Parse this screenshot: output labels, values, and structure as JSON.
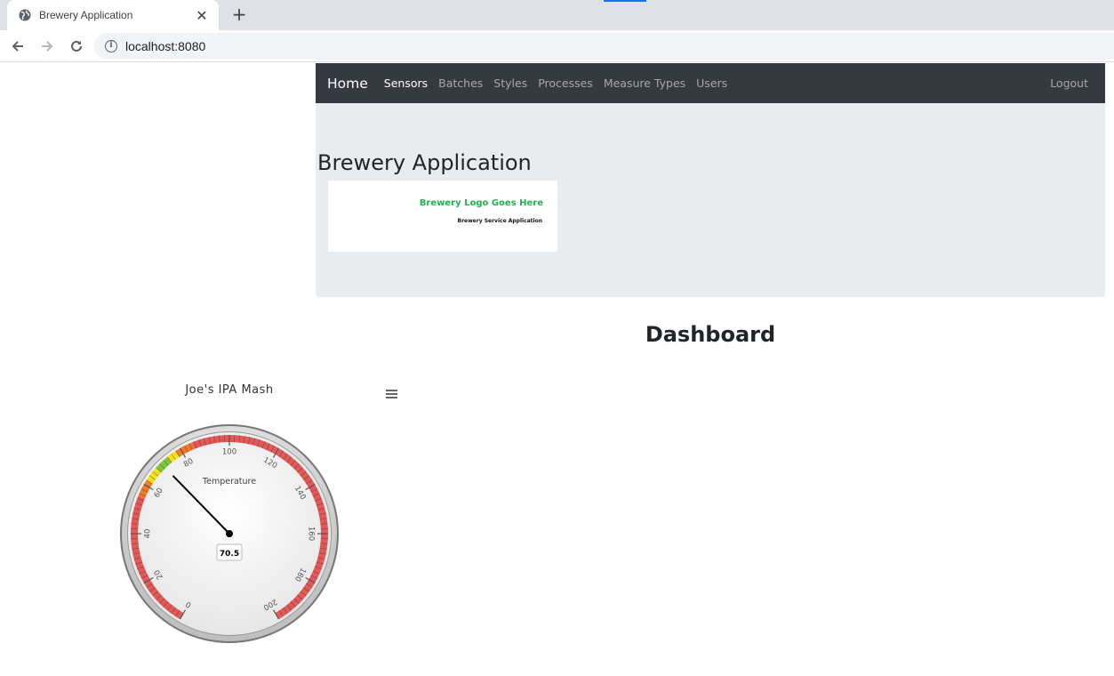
{
  "browser": {
    "tab_title": "Brewery Application",
    "tab_close": "✕",
    "new_tab": "+",
    "url": "localhost:8080"
  },
  "navbar": {
    "brand": "Home",
    "links": [
      {
        "label": "Sensors",
        "active": true
      },
      {
        "label": "Batches",
        "active": false
      },
      {
        "label": "Styles",
        "active": false
      },
      {
        "label": "Processes",
        "active": false
      },
      {
        "label": "Measure Types",
        "active": false
      },
      {
        "label": "Users",
        "active": false
      }
    ],
    "logout": "Logout"
  },
  "header": {
    "title": "Brewery Application",
    "logo_main": "Brewery Logo Goes Here",
    "logo_sub": "Brewery Service Application"
  },
  "dashboard": {
    "title": "Dashboard"
  },
  "chart_data": {
    "type": "gauge",
    "title": "Joe's IPA Mash",
    "pane_label": "Temperature",
    "value": 70.5,
    "value_label": "70.5",
    "min": 0,
    "max": 200,
    "tick_labels": [
      "0",
      "20",
      "40",
      "60",
      "80",
      "100",
      "120",
      "140",
      "160",
      "180",
      "200"
    ],
    "bands": [
      {
        "from": 0,
        "to": 55,
        "color": "#e05a5a"
      },
      {
        "from": 55,
        "to": 62,
        "color": "#ee7a2a"
      },
      {
        "from": 62,
        "to": 68,
        "color": "#f2e21a"
      },
      {
        "from": 68,
        "to": 74,
        "color": "#7cc83a"
      },
      {
        "from": 74,
        "to": 78,
        "color": "#f2e21a"
      },
      {
        "from": 78,
        "to": 85,
        "color": "#ee7a2a"
      },
      {
        "from": 85,
        "to": 200,
        "color": "#e05a5a"
      }
    ]
  }
}
